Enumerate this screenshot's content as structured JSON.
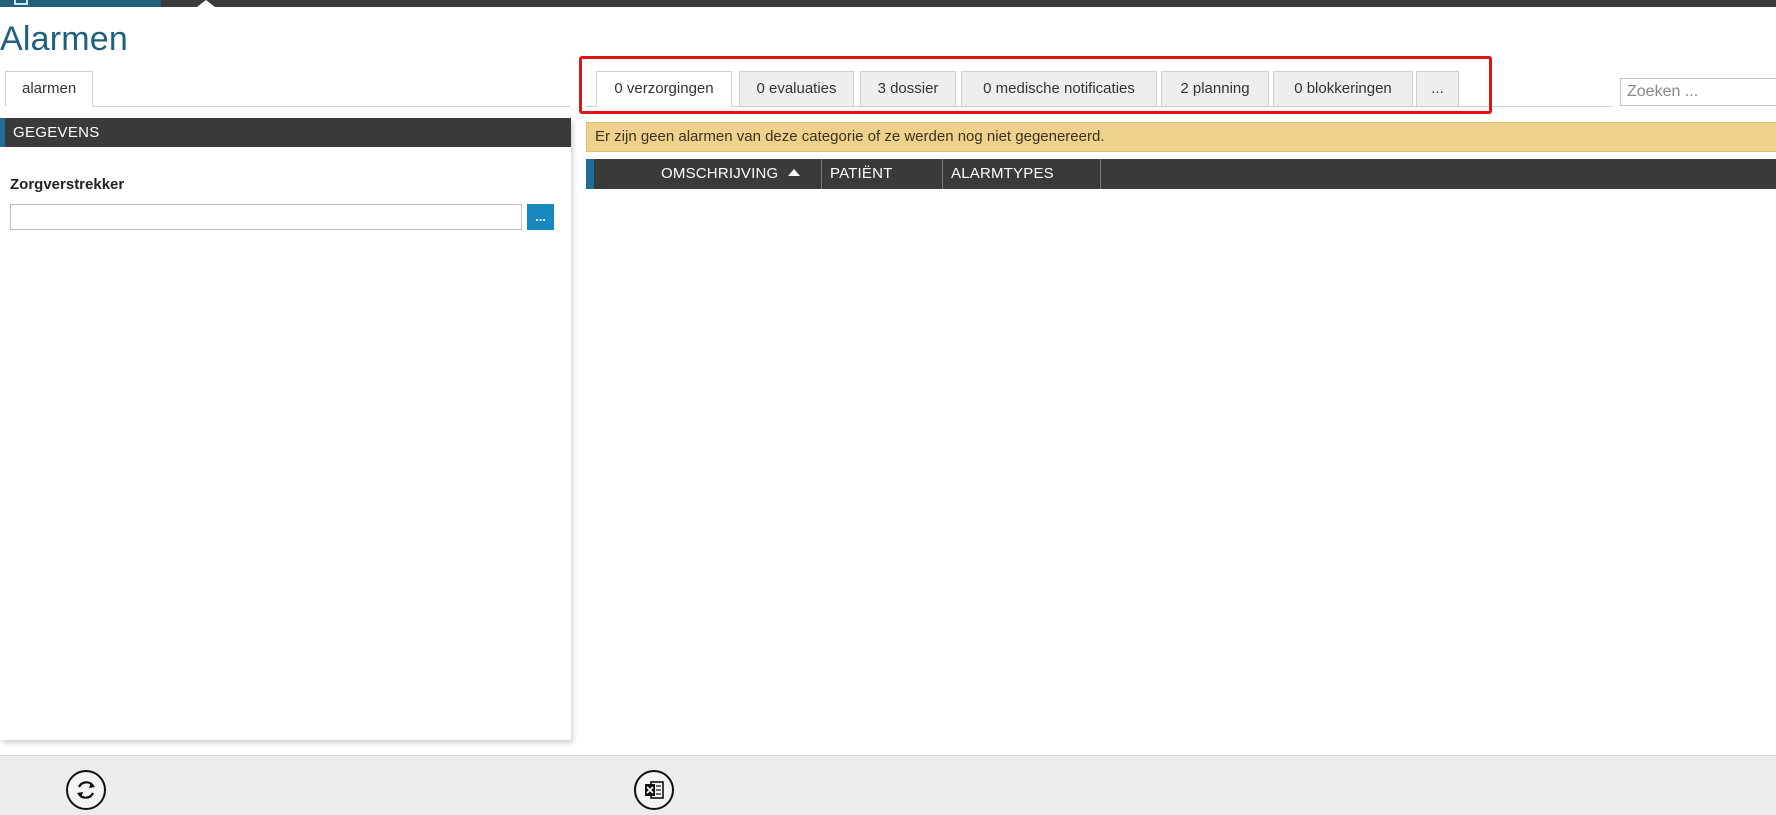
{
  "page": {
    "title": "Alarmen"
  },
  "left": {
    "tab_label": "alarmen",
    "section_header": "GEGEVENS",
    "field_label": "Zorgverstrekker",
    "field_value": "",
    "picker_label": "..."
  },
  "tabs": [
    {
      "label": "0 verzorgingen",
      "active": true
    },
    {
      "label": "0 evaluaties",
      "active": false
    },
    {
      "label": "3 dossier",
      "active": false
    },
    {
      "label": "0 medische notificaties",
      "active": false
    },
    {
      "label": "2 planning",
      "active": false
    },
    {
      "label": "0 blokkeringen",
      "active": false
    },
    {
      "label": "...",
      "active": false
    }
  ],
  "search": {
    "placeholder": "Zoeken ..."
  },
  "banner": {
    "text": "Er zijn geen alarmen van deze categorie of ze werden nog niet gegenereerd."
  },
  "table": {
    "columns": [
      "OMSCHRIJVING",
      "PATIËNT",
      "ALARMTYPES"
    ],
    "sort_column": "OMSCHRIJVING",
    "sort_direction": "ascending",
    "rows": []
  },
  "toolbar": {
    "buttons": [
      {
        "name": "refresh",
        "icon": "refresh-icon"
      },
      {
        "name": "export-excel",
        "icon": "excel-icon"
      }
    ]
  },
  "colors": {
    "accent": "#1f6e95",
    "title": "#1e6080",
    "header_bg": "#3a3a3a",
    "banner_bg": "#efd18b",
    "highlight": "#e01414",
    "picker_button": "#1a88c0"
  }
}
